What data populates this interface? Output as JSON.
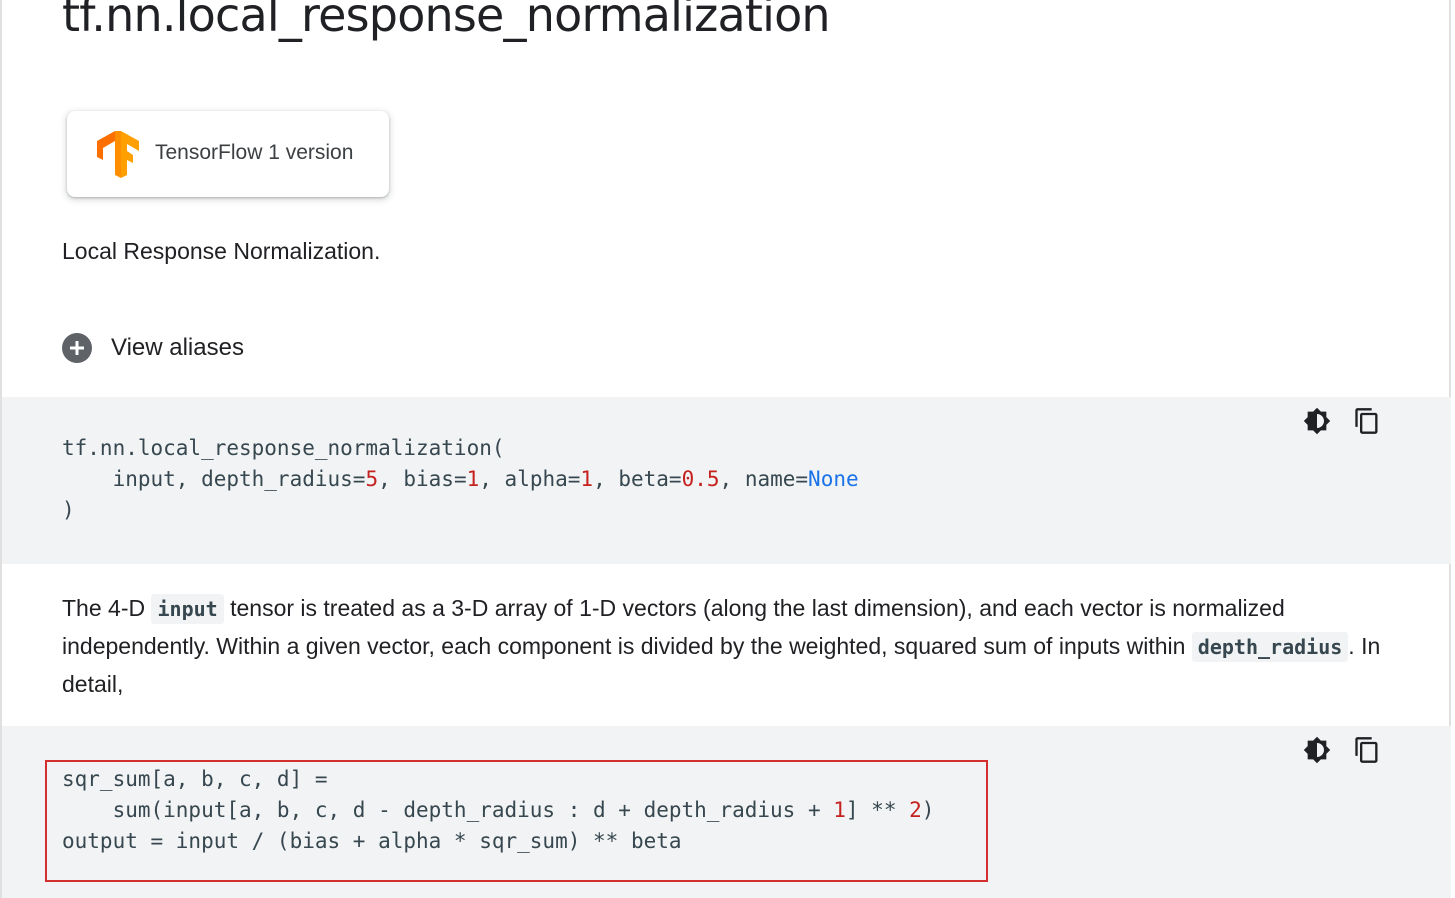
{
  "page": {
    "title": "tf.nn.local_response_normalization"
  },
  "tf1_button": {
    "label": "TensorFlow 1 version",
    "icon": "tensorflow-logo"
  },
  "description": "Local Response Normalization.",
  "aliases": {
    "label": "View aliases",
    "icon": "plus-circle-icon"
  },
  "signature_block": {
    "tools": [
      "theme-toggle-icon",
      "copy-icon"
    ],
    "line1": "tf.nn.local_response_normalization(",
    "line2_parts": [
      "    input, depth_radius=",
      "5",
      ", bias=",
      "1",
      ", alpha=",
      "1",
      ", beta=",
      "0.5",
      ", name=",
      "None"
    ],
    "line3": ")"
  },
  "paragraph": {
    "part1": "The 4-D ",
    "code1": "input",
    "part2": " tensor is treated as a 3-D array of 1-D vectors (along the last dimension), and each vector is normalized independently. Within a given vector, each component is divided by the weighted, squared sum of inputs within ",
    "code2": "depth_radius",
    "part3": ". In detail,"
  },
  "formula_block": {
    "tools": [
      "theme-toggle-icon",
      "copy-icon"
    ],
    "line1": "sqr_sum[a, b, c, d] =",
    "line2_parts": [
      "    sum(input[a, b, c, d - depth_radius : d + depth_radius + ",
      "1",
      "] ** ",
      "2",
      ")"
    ],
    "line3": "output = input / (bias + alpha * sqr_sum) ** beta"
  },
  "colors": {
    "code_background": "#f1f3f4",
    "number": "#c5221f",
    "keyword": "#1a73e8",
    "highlight_border": "#d32f2f",
    "logo_orange": "#ff8f00"
  }
}
